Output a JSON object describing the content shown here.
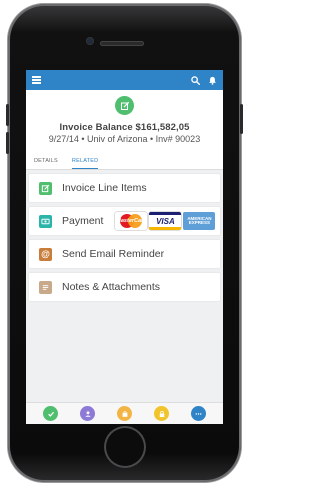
{
  "colors": {
    "topbar": "#2f84c8",
    "accent_green": "#4fbe6e",
    "line_items_icon": "#4fbe6e",
    "payment_icon": "#2bb5a8",
    "email_icon": "#c87d3a",
    "notes_icon": "#c8a98a",
    "bottom_icons": [
      "#4fbe6e",
      "#8c7ad6",
      "#f2b544",
      "#f2c42c",
      "#2f84c8"
    ]
  },
  "topbar": {
    "menu_icon": "hamburger-icon",
    "search_icon": "search-icon",
    "notification_icon": "bell-icon"
  },
  "header": {
    "icon": "edit-icon",
    "title": "Invoice Balance $161,582,05",
    "subtitle": "9/27/14 • Univ of Arizona • Inv# 90023"
  },
  "tabs": [
    {
      "label": "DETAILS",
      "active": false
    },
    {
      "label": "RELATED",
      "active": true
    }
  ],
  "items": [
    {
      "label": "Invoice Line Items",
      "icon": "edit-icon"
    },
    {
      "label": "Payment",
      "icon": "payment-icon"
    },
    {
      "label": "Send Email Reminder",
      "icon": "at-icon"
    },
    {
      "label": "Notes & Attachments",
      "icon": "document-icon"
    }
  ],
  "payment_cards": {
    "mastercard": "MasterCard",
    "visa": "VISA",
    "amex": "AMERICAN EXPRESS"
  },
  "bottom_bar": [
    {
      "icon": "check-icon"
    },
    {
      "icon": "contact-icon"
    },
    {
      "icon": "bag-icon"
    },
    {
      "icon": "lock-icon"
    },
    {
      "icon": "more-icon"
    }
  ]
}
